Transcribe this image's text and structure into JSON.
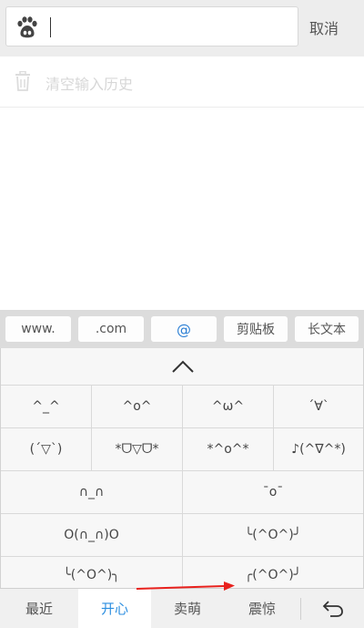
{
  "search": {
    "cancel_label": "取消",
    "value": ""
  },
  "history": {
    "clear_label": "清空输入历史"
  },
  "shortcuts": [
    "www.",
    ".com",
    "@",
    "剪贴板",
    "长文本"
  ],
  "emoticons": [
    [
      "^_^",
      "^o^",
      "^ω^",
      "´∀`"
    ],
    [
      "(´▽`)",
      "*ᗜ▽ᗜ*",
      "*^o^*",
      "♪(^∇^*)"
    ],
    [
      "∩_∩",
      "¯o¯"
    ],
    [
      "O(∩_∩)O",
      "╰(^O^)╯"
    ],
    [
      "╰(^O^)╮",
      "╭(^O^)╯"
    ]
  ],
  "categories": [
    {
      "label": "最近",
      "active": false
    },
    {
      "label": "开心",
      "active": true
    },
    {
      "label": "卖萌",
      "active": false
    },
    {
      "label": "震惊",
      "active": false
    }
  ],
  "colors": {
    "accent": "#2b8ee0",
    "annotation_arrow": "#e8211d"
  },
  "icons": {
    "search_logo": "baidu-paw-icon",
    "history": "trash-icon",
    "collapse": "chevron-up-icon",
    "back": "return-arrow-icon"
  }
}
